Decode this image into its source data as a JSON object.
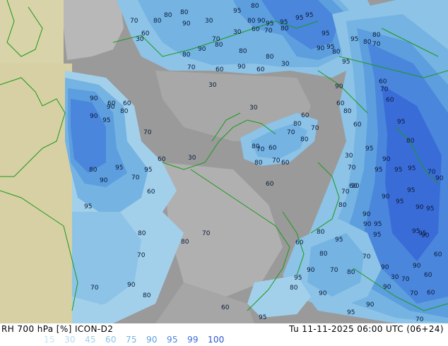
{
  "header": {
    "title": "RH 700 hPa [%] ICON-D2",
    "valid_time": "Tu 11-11-2025 06:00 UTC (06+24)"
  },
  "legend": {
    "items": [
      {
        "label": "15",
        "color": "#c8e4f2"
      },
      {
        "label": "30",
        "color": "#b4d9ee"
      },
      {
        "label": "45",
        "color": "#a2d0ea"
      },
      {
        "label": "60",
        "color": "#8cc3e6"
      },
      {
        "label": "75",
        "color": "#74b3e2"
      },
      {
        "label": "90",
        "color": "#5c9ede"
      },
      {
        "label": "95",
        "color": "#4a86dc"
      },
      {
        "label": "99",
        "color": "#3a6cd8"
      },
      {
        "label": "100",
        "color": "#2a54d0"
      }
    ]
  },
  "map": {
    "contour_labels": [
      "80",
      "95",
      "80",
      "80",
      "70",
      "60",
      "30",
      "80",
      "90",
      "95",
      "95",
      "95",
      "95",
      "80",
      "90",
      "60",
      "70",
      "80",
      "30",
      "70",
      "80",
      "90",
      "80",
      "30",
      "80",
      "30",
      "95",
      "90",
      "95",
      "95",
      "80",
      "80",
      "80",
      "95",
      "90",
      "70",
      "60",
      "70",
      "60",
      "60",
      "80",
      "90",
      "30",
      "70",
      "60",
      "90",
      "80",
      "90",
      "60",
      "60",
      "60",
      "70",
      "70",
      "60",
      "30",
      "60",
      "30",
      "80",
      "70",
      "70",
      "60",
      "80",
      "80",
      "70",
      "60",
      "90",
      "60",
      "95",
      "70",
      "80",
      "95",
      "80",
      "90",
      "60",
      "80",
      "95",
      "95",
      "95",
      "60",
      "95",
      "90",
      "95",
      "95",
      "80",
      "90",
      "95",
      "95",
      "95",
      "90",
      "95",
      "30",
      "80",
      "90",
      "95",
      "90",
      "70",
      "90",
      "70",
      "60",
      "95",
      "70",
      "90",
      "95",
      "80",
      "95",
      "90",
      "60",
      "60",
      "70",
      "90",
      "95",
      "70",
      "90",
      "80",
      "90",
      "30",
      "70",
      "95",
      "90",
      "60",
      "60",
      "80",
      "70",
      "90",
      "90",
      "95",
      "80",
      "95",
      "80",
      "70",
      "90",
      "70",
      "80",
      "80",
      "70",
      "60",
      "70",
      "80",
      "60",
      "60",
      "70",
      "30",
      "60"
    ]
  }
}
